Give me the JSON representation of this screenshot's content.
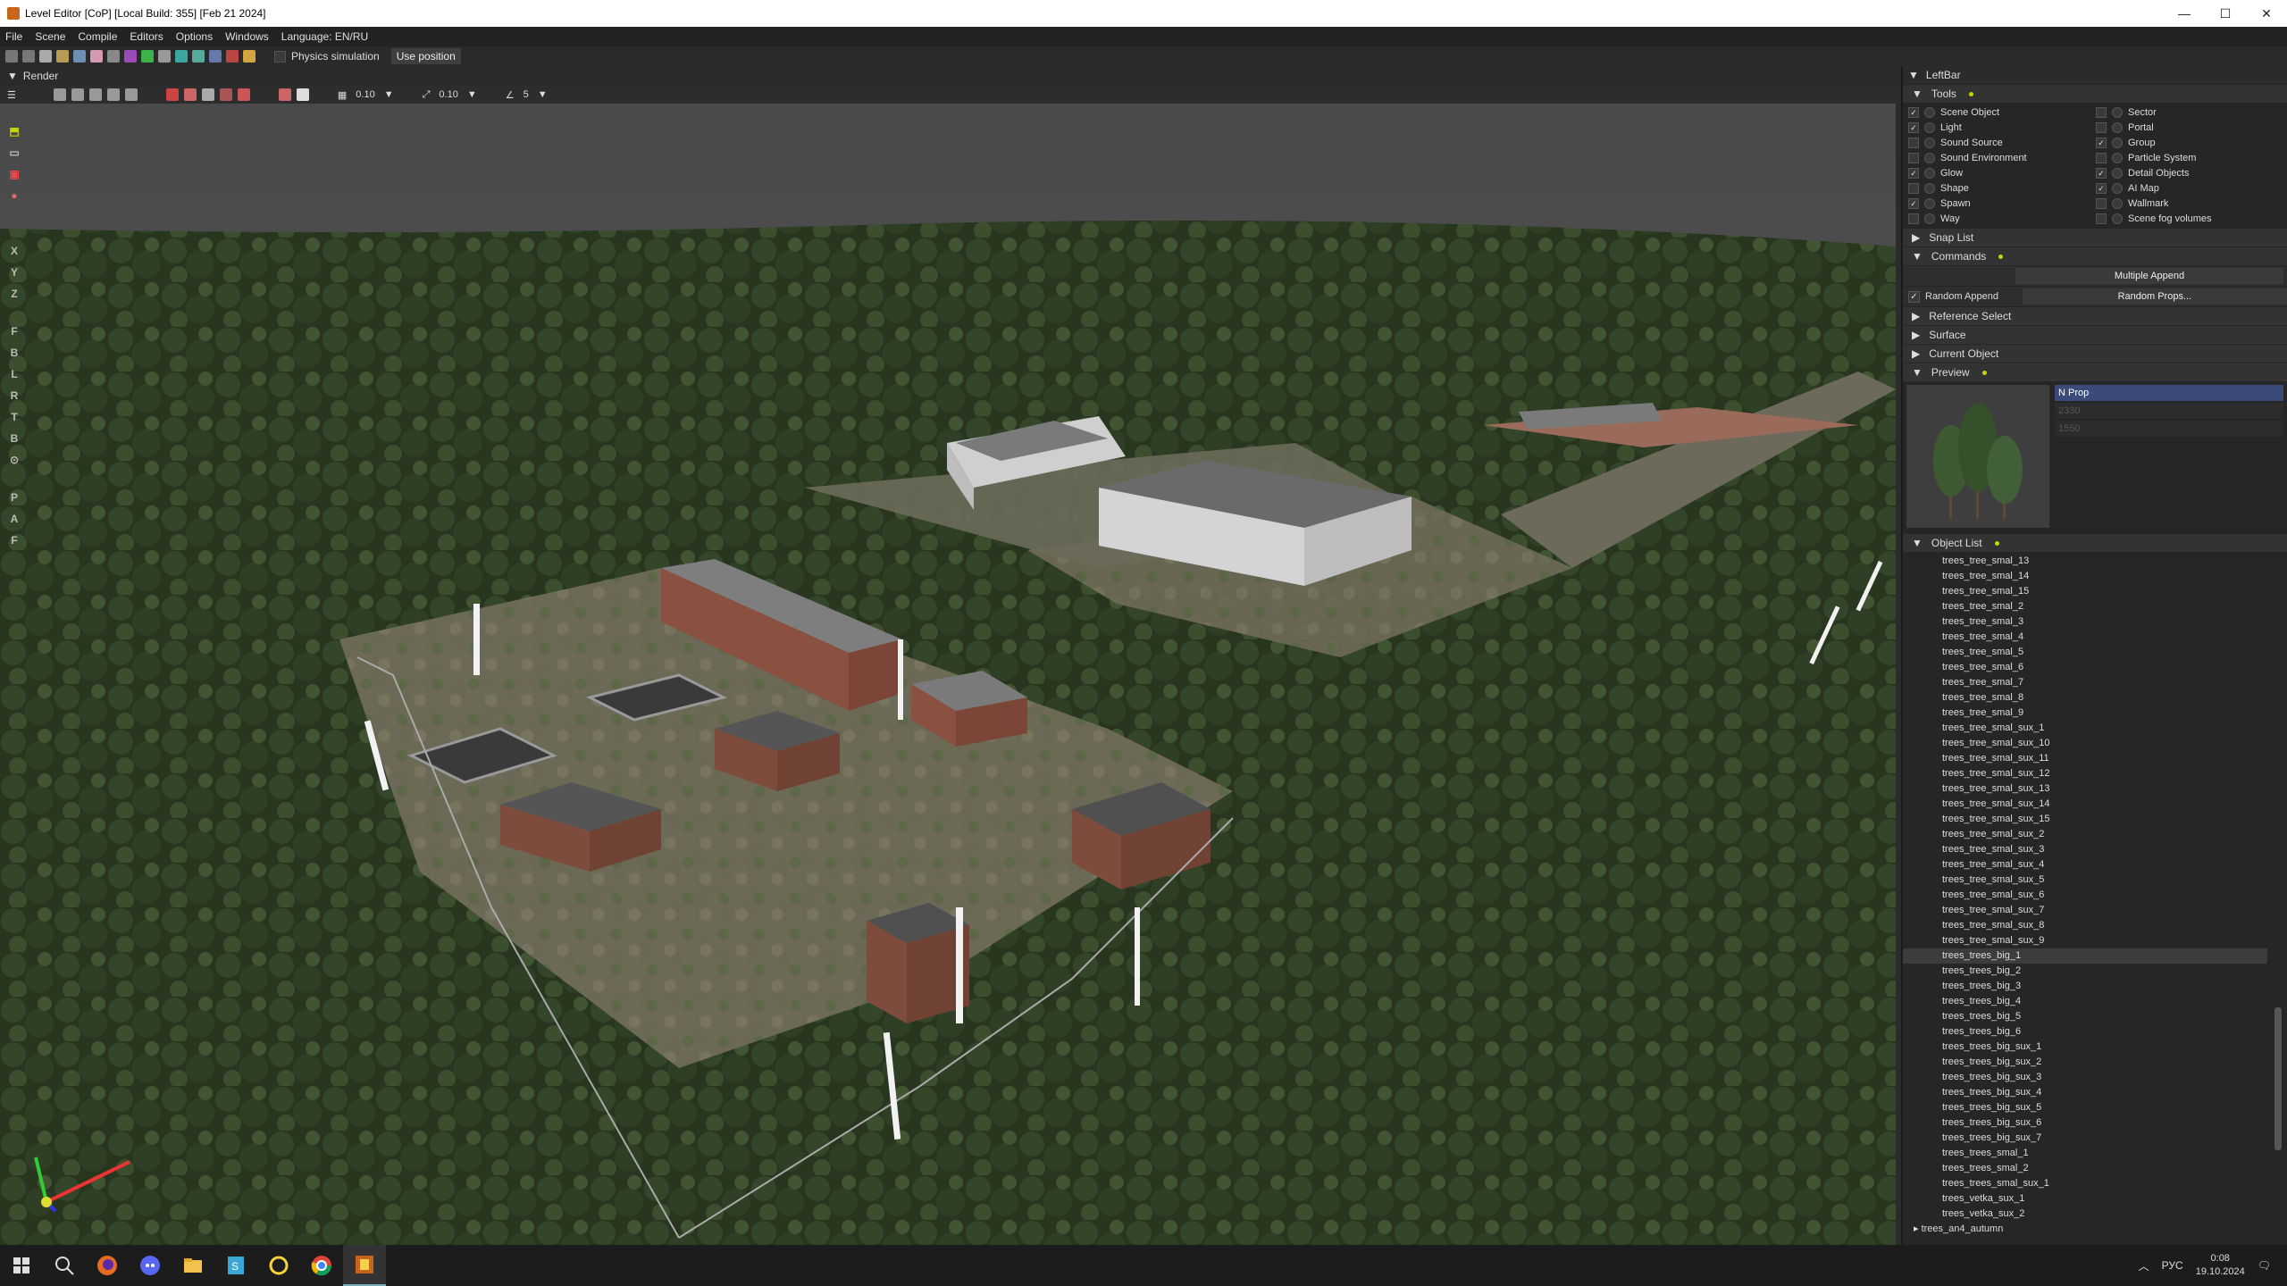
{
  "window": {
    "title": "Level Editor [CoP] [Local Build: 355] [Feb 21 2024]",
    "minimize": "—",
    "maximize": "☐",
    "close": "✕"
  },
  "menu": {
    "items": [
      "File",
      "Scene",
      "Compile",
      "Editors",
      "Options",
      "Windows",
      "Language: EN/RU"
    ]
  },
  "toolbar": {
    "physics_label": "Physics simulation",
    "use_position_label": "Use position"
  },
  "render": {
    "title": "Render",
    "grid_value": "0.10",
    "scale_value": "0.10",
    "angle_value": "5"
  },
  "left_icons": [
    "X",
    "Y",
    "Z",
    "F",
    "B",
    "L",
    "R",
    "T",
    "B",
    "P",
    "A",
    "F"
  ],
  "right_panel": {
    "title": "LeftBar",
    "tools": {
      "label": "Tools",
      "left": [
        {
          "label": "Scene Object",
          "checked": true
        },
        {
          "label": "Light",
          "checked": true
        },
        {
          "label": "Sound Source",
          "checked": false
        },
        {
          "label": "Sound Environment",
          "checked": false
        },
        {
          "label": "Glow",
          "checked": true
        },
        {
          "label": "Shape",
          "checked": false
        },
        {
          "label": "Spawn",
          "checked": true
        },
        {
          "label": "Way",
          "checked": false
        }
      ],
      "right": [
        {
          "label": "Sector",
          "checked": false
        },
        {
          "label": "Portal",
          "checked": false
        },
        {
          "label": "Group",
          "checked": true
        },
        {
          "label": "Particle System",
          "checked": false
        },
        {
          "label": "Detail Objects",
          "checked": true
        },
        {
          "label": "AI Map",
          "checked": true
        },
        {
          "label": "Wallmark",
          "checked": false
        },
        {
          "label": "Scene fog volumes",
          "checked": false
        }
      ]
    },
    "snap_list": "Snap List",
    "commands": "Commands",
    "multiple_append": "Multiple Append",
    "random_append": "Random Append",
    "random_props": "Random Props...",
    "reference_select": "Reference Select",
    "surface": "Surface",
    "current_object": "Current Object",
    "preview": {
      "label": "Preview",
      "selected": "N Prop",
      "line2": "2330",
      "line3": "1550"
    },
    "object_list": {
      "label": "Object List",
      "items": [
        "trees_tree_smal_13",
        "trees_tree_smal_14",
        "trees_tree_smal_15",
        "trees_tree_smal_2",
        "trees_tree_smal_3",
        "trees_tree_smal_4",
        "trees_tree_smal_5",
        "trees_tree_smal_6",
        "trees_tree_smal_7",
        "trees_tree_smal_8",
        "trees_tree_smal_9",
        "trees_tree_smal_sux_1",
        "trees_tree_smal_sux_10",
        "trees_tree_smal_sux_11",
        "trees_tree_smal_sux_12",
        "trees_tree_smal_sux_13",
        "trees_tree_smal_sux_14",
        "trees_tree_smal_sux_15",
        "trees_tree_smal_sux_2",
        "trees_tree_smal_sux_3",
        "trees_tree_smal_sux_4",
        "trees_tree_smal_sux_5",
        "trees_tree_smal_sux_6",
        "trees_tree_smal_sux_7",
        "trees_tree_smal_sux_8",
        "trees_tree_smal_sux_9",
        "trees_trees_big_1",
        "trees_trees_big_2",
        "trees_trees_big_3",
        "trees_trees_big_4",
        "trees_trees_big_5",
        "trees_trees_big_6",
        "trees_trees_big_sux_1",
        "trees_trees_big_sux_2",
        "trees_trees_big_sux_3",
        "trees_trees_big_sux_4",
        "trees_trees_big_sux_5",
        "trees_trees_big_sux_6",
        "trees_trees_big_sux_7",
        "trees_trees_smal_1",
        "trees_trees_smal_2",
        "trees_trees_smal_sux_1",
        "trees_vetka_sux_1",
        "trees_vetka_sux_2"
      ],
      "selected_index": 26,
      "folder": "trees_an4_autumn"
    }
  },
  "taskbar": {
    "lang": "РУС",
    "time": "0:08",
    "date": "19.10.2024"
  },
  "colors": {
    "accent_dot": "#c8d400",
    "selection": "#3b4a78"
  }
}
